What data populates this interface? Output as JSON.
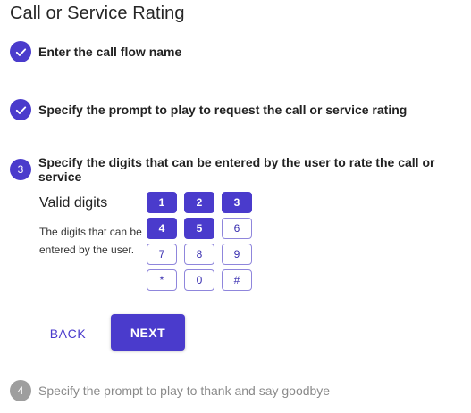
{
  "page": {
    "title": "Call or Service Rating"
  },
  "steps": [
    {
      "number": "1",
      "label": "Enter the call flow name",
      "state": "completed"
    },
    {
      "number": "2",
      "label": "Specify the prompt to play to request the call or service rating",
      "state": "completed"
    },
    {
      "number": "3",
      "label": "Specify the digits that can be entered by the user to rate the call or service",
      "state": "active"
    },
    {
      "number": "4",
      "label": "Specify the prompt to play to thank and say goodbye",
      "state": "pending"
    }
  ],
  "digits": {
    "title": "Valid digits",
    "description": "The digits that can be entered by the user.",
    "keys": [
      {
        "label": "1",
        "selected": true
      },
      {
        "label": "2",
        "selected": true
      },
      {
        "label": "3",
        "selected": true
      },
      {
        "label": "4",
        "selected": true
      },
      {
        "label": "5",
        "selected": true
      },
      {
        "label": "6",
        "selected": false
      },
      {
        "label": "7",
        "selected": false
      },
      {
        "label": "8",
        "selected": false
      },
      {
        "label": "9",
        "selected": false
      },
      {
        "label": "*",
        "selected": false
      },
      {
        "label": "0",
        "selected": false
      },
      {
        "label": "#",
        "selected": false
      }
    ]
  },
  "actions": {
    "back_label": "BACK",
    "next_label": "NEXT"
  },
  "icons": {
    "completed_step": "check-icon"
  },
  "colors": {
    "accent": "#4a3bcc",
    "pending": "#9e9e9e",
    "connector": "#bdbdbd"
  }
}
